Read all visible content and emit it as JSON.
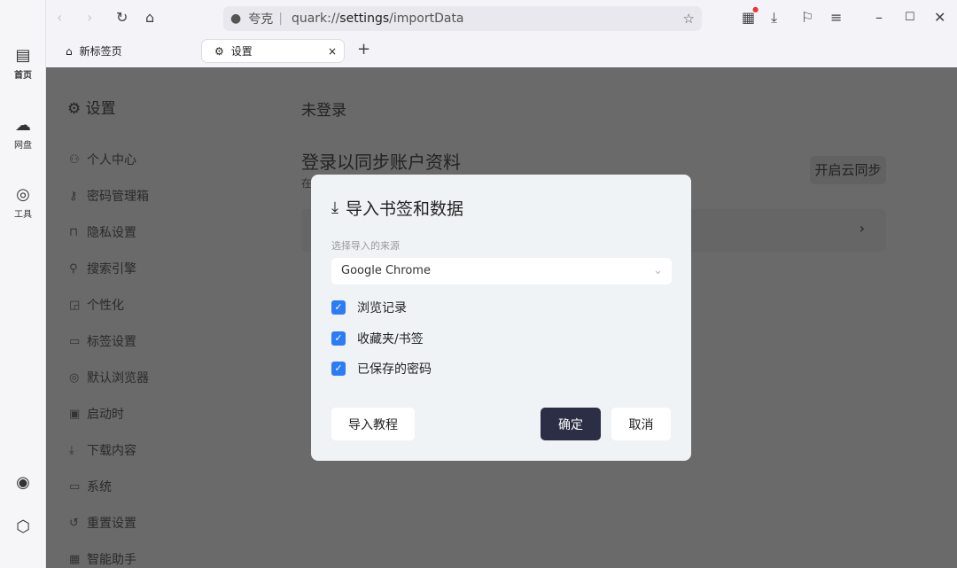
{
  "rail": {
    "items": [
      {
        "label": "首页",
        "icon": "home-panel-icon"
      },
      {
        "label": "网盘",
        "icon": "cloud-icon"
      },
      {
        "label": "工具",
        "icon": "scan-icon"
      }
    ]
  },
  "toolbar": {
    "site_name": "夸克",
    "url_prefix": "quark://",
    "url_host": "settings",
    "url_path": "/importData"
  },
  "tabs": [
    {
      "label": "新标签页"
    },
    {
      "label": "设置",
      "close": "×"
    }
  ],
  "new_tab": "+",
  "settings": {
    "title": "设置",
    "nav": [
      "个人中心",
      "密码管理箱",
      "隐私设置",
      "搜索引擎",
      "个性化",
      "标签设置",
      "默认浏览器",
      "启动时",
      "下载内容",
      "系统",
      "重置设置",
      "智能助手"
    ]
  },
  "account": {
    "status": "未登录",
    "heading": "登录以同步账户资料",
    "subtitle": "在",
    "sync_button": "开启云同步"
  },
  "dialog": {
    "title": "导入书签和数据",
    "source_label": "选择导入的来源",
    "source_value": "Google Chrome",
    "options": [
      {
        "label": "浏览记录",
        "checked": true
      },
      {
        "label": "收藏夹/书签",
        "checked": true
      },
      {
        "label": "已保存的密码",
        "checked": true
      }
    ],
    "tutorial": "导入教程",
    "confirm": "确定",
    "cancel": "取消"
  },
  "colors": {
    "accent": "#2d7cf6",
    "confirm_bg": "#2b2e45",
    "overlay": "#6a6a6a"
  }
}
